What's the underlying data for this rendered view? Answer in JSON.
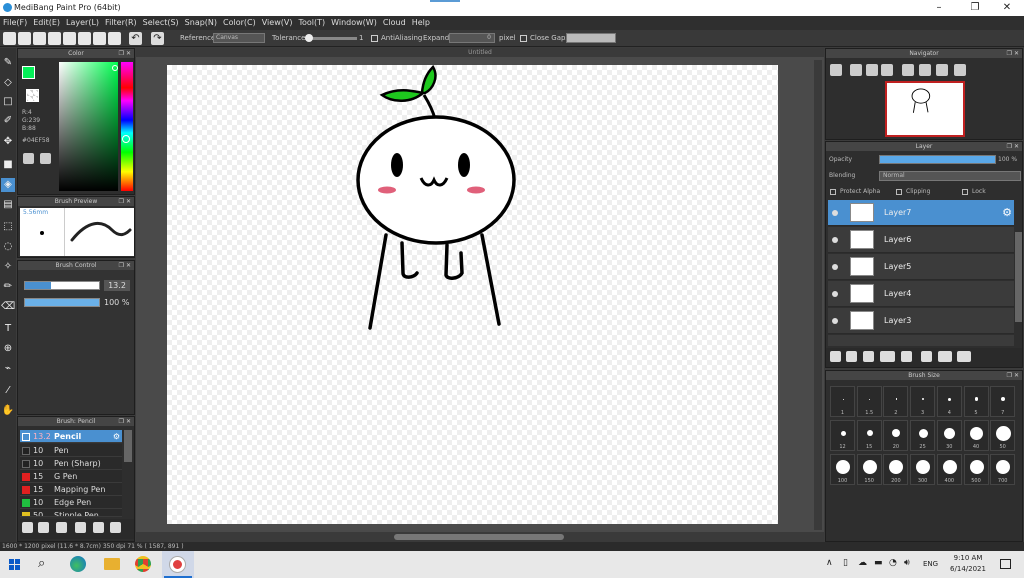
{
  "window": {
    "title": "MediBang Paint Pro (64bit)",
    "min": "–",
    "max": "❐",
    "close": "✕"
  },
  "menu": [
    "File(F)",
    "Edit(E)",
    "Layer(L)",
    "Filter(R)",
    "Select(S)",
    "Snap(N)",
    "Color(C)",
    "View(V)",
    "Tool(T)",
    "Window(W)",
    "Cloud",
    "Help"
  ],
  "toolbar": {
    "reference_label": "Reference",
    "reference_value": "Canvas",
    "tolerance_label": "Tolerance",
    "tolerance_value": "1",
    "antialiasing_label": "AntiAliasing",
    "expand_label": "Expand",
    "expand_value": "0",
    "pixel_label": "pixel",
    "closegaps_label": "Close Gaps"
  },
  "color_panel": {
    "title": "Color",
    "r": "R:4",
    "g": "G:239",
    "b": "B:88",
    "hex": "#04EF58",
    "primary": "#04EF58"
  },
  "brush_preview": {
    "title": "Brush Preview",
    "size": "5.56mm"
  },
  "brush_control": {
    "title": "Brush Control",
    "size_value": "13.2",
    "size_fraction": 0.35,
    "opacity_value": "100 %",
    "opacity_fraction": 1.0
  },
  "brush_list": {
    "title": "Brush: Pencil",
    "items": [
      {
        "size": "13.2",
        "name": "Pencil",
        "color": "#4a90d0",
        "selected": true
      },
      {
        "size": "10",
        "name": "Pen",
        "color": "#222222"
      },
      {
        "size": "10",
        "name": "Pen (Sharp)",
        "color": "#222222"
      },
      {
        "size": "15",
        "name": "G Pen",
        "color": "#e02020"
      },
      {
        "size": "15",
        "name": "Mapping Pen",
        "color": "#e02020"
      },
      {
        "size": "10",
        "name": "Edge Pen",
        "color": "#20c040"
      },
      {
        "size": "50",
        "name": "Stipple Pen",
        "color": "#e0c020"
      }
    ]
  },
  "canvas": {
    "tab": "Untitled"
  },
  "navigator": {
    "title": "Navigator"
  },
  "layer_panel": {
    "title": "Layer",
    "opacity_label": "Opacity",
    "opacity_value": "100 %",
    "opacity_fraction": 1.0,
    "blending_label": "Blending",
    "blending_value": "Normal",
    "protect_alpha": "Protect Alpha",
    "clipping": "Clipping",
    "lock": "Lock",
    "layers": [
      {
        "name": "Layer7",
        "selected": true
      },
      {
        "name": "Layer6"
      },
      {
        "name": "Layer5"
      },
      {
        "name": "Layer4"
      },
      {
        "name": "Layer3"
      }
    ]
  },
  "brush_size": {
    "title": "Brush Size",
    "rows": [
      [
        "1",
        "1.5",
        "2",
        "3",
        "4",
        "5",
        "7"
      ],
      [
        "12",
        "15",
        "20",
        "25",
        "30",
        "40",
        "50"
      ],
      [
        "100",
        "150",
        "200",
        "300",
        "400",
        "500",
        "700"
      ]
    ]
  },
  "status": {
    "text": "1600 * 1200 pixel  (11.6 * 8.7cm)  350 dpi  71 %  ( 1587, 891 )"
  },
  "taskbar": {
    "time": "9:10 AM",
    "date": "6/14/2021",
    "lang": "ENG"
  }
}
